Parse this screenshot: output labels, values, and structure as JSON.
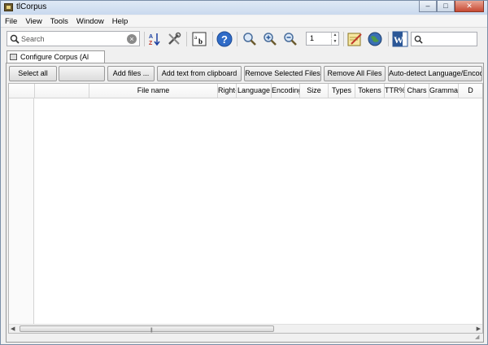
{
  "window": {
    "title": "tlCorpus",
    "controls": [
      "–",
      "□",
      "✕"
    ]
  },
  "menu": [
    "File",
    "View",
    "Tools",
    "Window",
    "Help"
  ],
  "toolbar": {
    "search_placeholder": "Search",
    "page_value": "1",
    "icons": [
      "sort-az-icon",
      "tools-icon",
      "text-format-icon",
      "help-icon",
      "zoom-reset-icon",
      "zoom-in-icon",
      "zoom-out-icon",
      "notepad-icon",
      "globe-icon",
      "word-icon"
    ]
  },
  "tab": {
    "label": "Configure Corpus (Al"
  },
  "buttons": [
    "Select all",
    "",
    "Add files ...",
    "Add text from clipboard",
    "Remove Selected Files",
    "Remove All Files",
    "Auto-detect Language/Encoding"
  ],
  "columns": [
    "",
    "File name",
    "Right-to-",
    "Language",
    "Encoding",
    "Size",
    "Types",
    "Tokens",
    "TTR%",
    "Chars",
    "Grammar Type",
    "D"
  ],
  "colors": {
    "title_bar": "#c9d9ee",
    "close_button": "#c74a33",
    "panel_bg": "#f0f0f0"
  }
}
